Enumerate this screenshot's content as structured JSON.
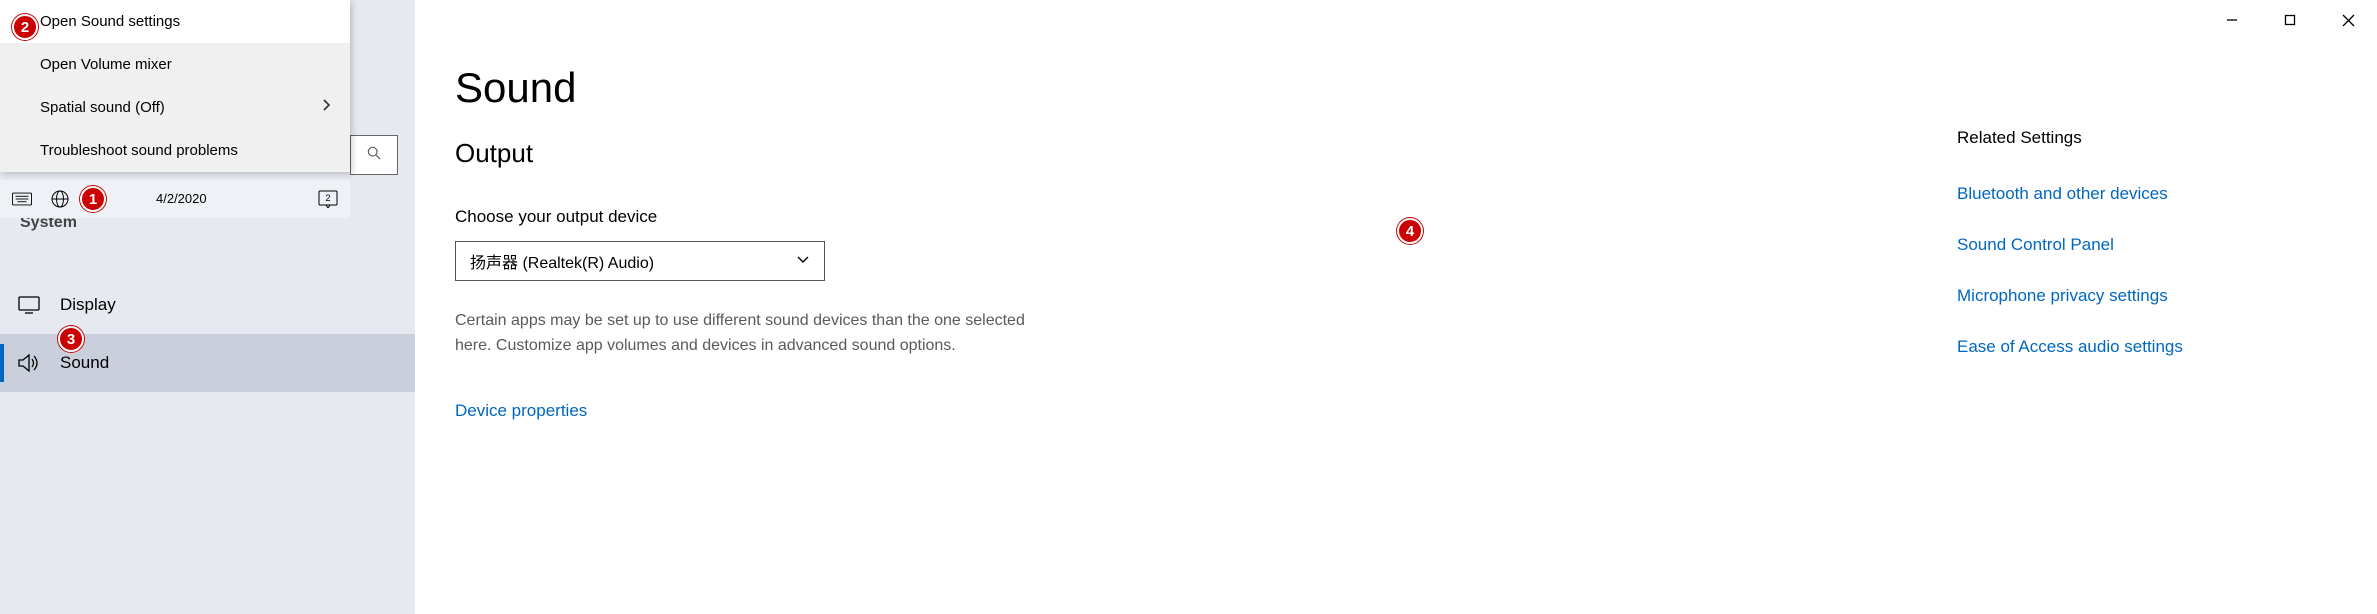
{
  "context_menu": {
    "items": [
      {
        "label": "Open Sound settings",
        "selected": true,
        "submenu": false
      },
      {
        "label": "Open Volume mixer",
        "selected": false,
        "submenu": false
      },
      {
        "label": "Spatial sound (Off)",
        "selected": false,
        "submenu": true
      },
      {
        "label": "Troubleshoot sound problems",
        "selected": false,
        "submenu": false
      }
    ]
  },
  "tray": {
    "date": "4/2/2020"
  },
  "sidebar": {
    "category": "System",
    "items": [
      {
        "label": "Display",
        "active": false
      },
      {
        "label": "Sound",
        "active": true
      }
    ]
  },
  "page": {
    "title": "Sound",
    "section_output": "Output",
    "output_label": "Choose your output device",
    "output_device": "扬声器 (Realtek(R) Audio)",
    "output_hint": "Certain apps may be set up to use different sound devices than the one selected here. Customize app volumes and devices in advanced sound options.",
    "device_props_link": "Device properties"
  },
  "related": {
    "title": "Related Settings",
    "links": [
      "Bluetooth and other devices",
      "Sound Control Panel",
      "Microphone privacy settings",
      "Ease of Access audio settings"
    ]
  },
  "badges": {
    "b1": "1",
    "b2": "2",
    "b3": "3",
    "b4": "4"
  }
}
